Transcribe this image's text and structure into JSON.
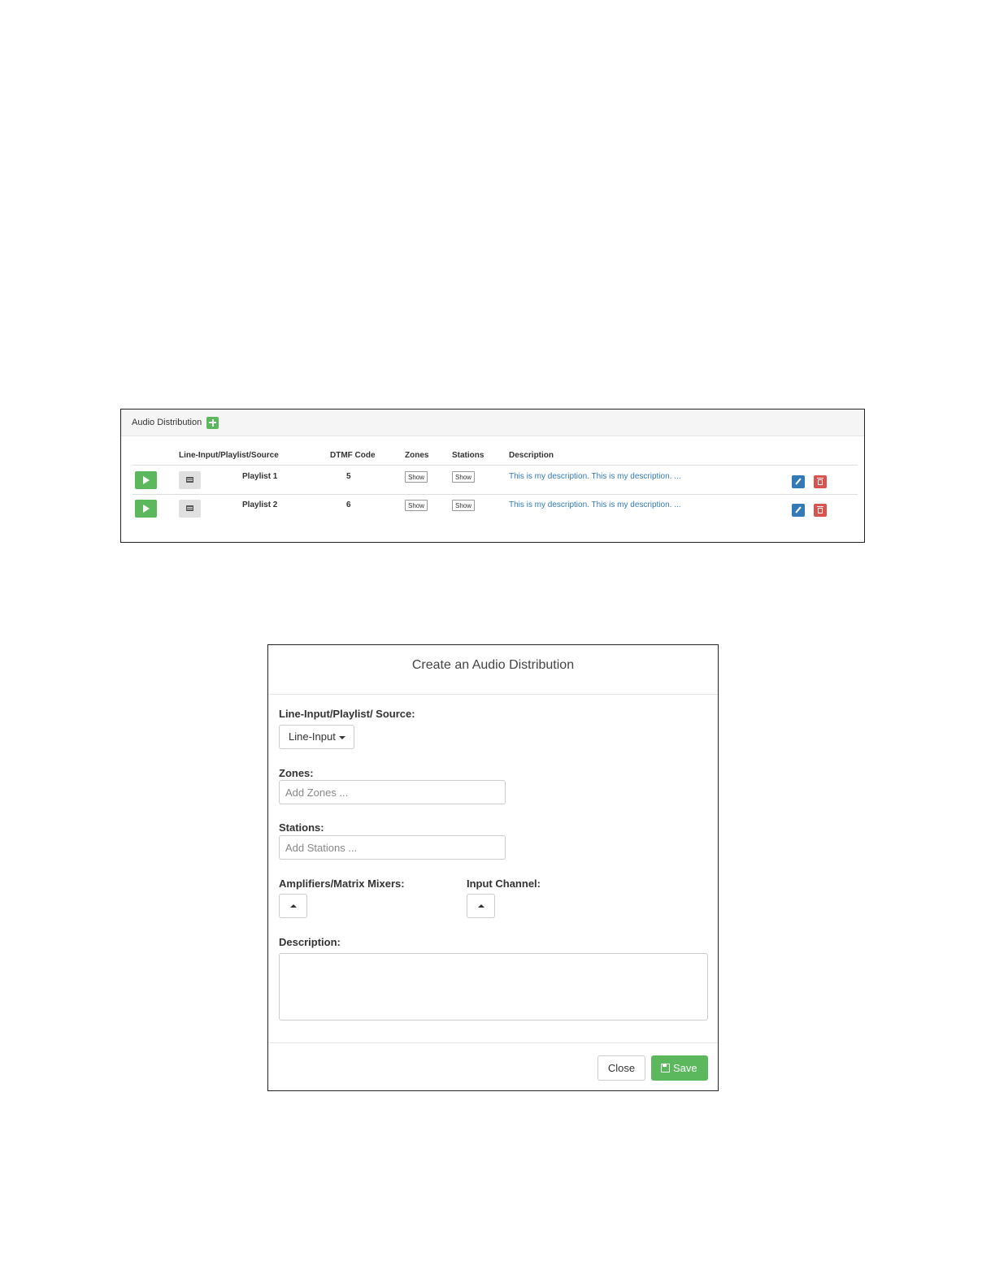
{
  "panel": {
    "title": "Audio Distribution",
    "columns": {
      "source": "Line-Input/Playlist/Source",
      "dtmf": "DTMF Code",
      "zones": "Zones",
      "stations": "Stations",
      "description": "Description"
    },
    "rows": [
      {
        "name": "Playlist 1",
        "dtmf": "5",
        "zones_btn": "Show",
        "stations_btn": "Show",
        "description": "This is my description. This is my description. ..."
      },
      {
        "name": "Playlist 2",
        "dtmf": "6",
        "zones_btn": "Show",
        "stations_btn": "Show",
        "description": "This is my description. This is my description. ..."
      }
    ]
  },
  "modal": {
    "title": "Create an Audio Distribution",
    "source_label": "Line-Input/Playlist/ Source:",
    "source_value": "Line-Input",
    "zones_label": "Zones:",
    "zones_placeholder": "Add Zones ...",
    "stations_label": "Stations:",
    "stations_placeholder": "Add Stations ...",
    "amplifiers_label": "Amplifiers/Matrix Mixers:",
    "input_channel_label": "Input Channel:",
    "description_label": "Description:",
    "close_label": "Close",
    "save_label": "Save"
  },
  "colors": {
    "success": "#5cb85c",
    "primary": "#337ab7",
    "danger": "#d9534f"
  }
}
